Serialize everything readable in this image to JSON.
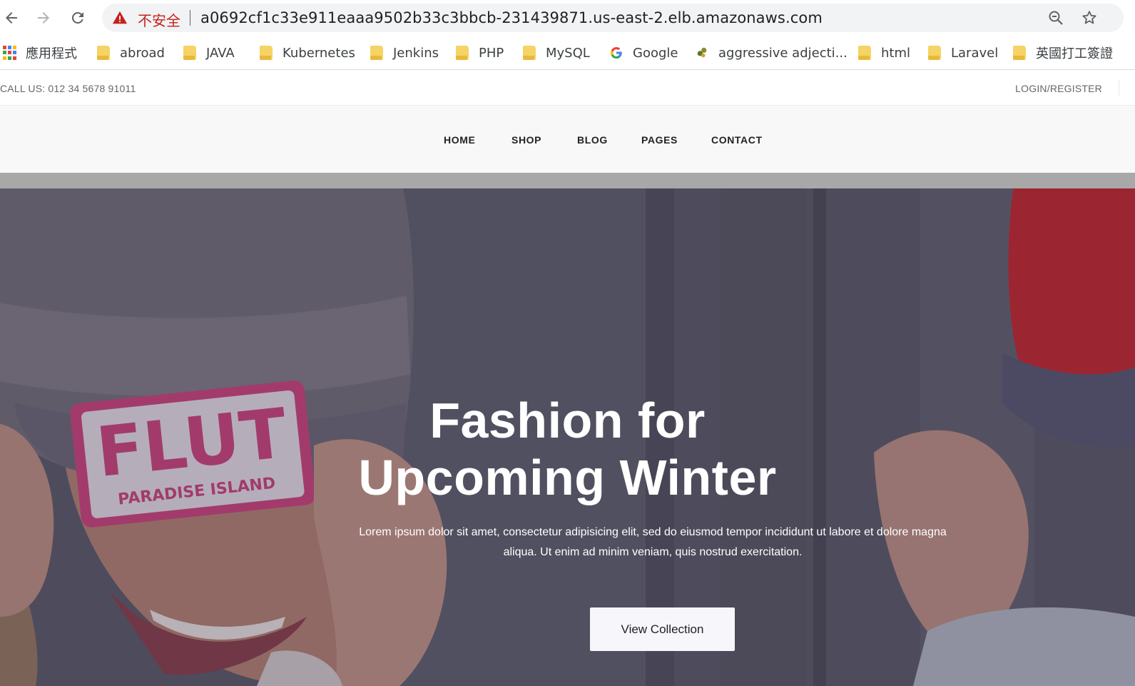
{
  "browser": {
    "security_label": "不安全",
    "url": "a0692cf1c33e911eaaa9502b33c3bbcb-231439871.us-east-2.elb.amazonaws.com",
    "icons": [
      "back-arrow-icon",
      "forward-arrow-icon",
      "reload-icon",
      "warning-triangle-icon",
      "zoom-icon",
      "star-icon"
    ]
  },
  "bookmarks": [
    {
      "label": "應用程式",
      "icon": "apps-grid-icon"
    },
    {
      "label": "abroad",
      "icon": "folder-icon"
    },
    {
      "label": "JAVA",
      "icon": "folder-icon"
    },
    {
      "label": "Kubernetes",
      "icon": "folder-icon"
    },
    {
      "label": "Jenkins",
      "icon": "folder-icon"
    },
    {
      "label": "PHP",
      "icon": "folder-icon"
    },
    {
      "label": "MySQL",
      "icon": "folder-icon"
    },
    {
      "label": "Google",
      "icon": "google-icon"
    },
    {
      "label": "aggressive adjecti...",
      "icon": "site-favicon-icon"
    },
    {
      "label": "html",
      "icon": "folder-icon"
    },
    {
      "label": "Laravel",
      "icon": "folder-icon"
    },
    {
      "label": "英國打工簽證",
      "icon": "folder-icon"
    }
  ],
  "topbar": {
    "call_us": "CALL US: 012 34 5678 91011",
    "login": "LOGIN/REGISTER"
  },
  "nav": {
    "items": [
      "HOME",
      "SHOP",
      "BLOG",
      "PAGES",
      "CONTACT"
    ]
  },
  "hero": {
    "title_line1": "Fashion for",
    "title_line2": "Upcoming Winter",
    "description_line1": "Lorem ipsum dolor sit amet, consectetur adipisicing elit, sed do eiusmod tempor incididunt ut labore et dolore magna",
    "description_line2": "aliqua. Ut enim ad minim veniam, quis nostrud exercitation.",
    "button": "View Collection",
    "patch_text_main": "FLUT",
    "patch_text_sub": "PARADISE ISLAND"
  },
  "colors": {
    "warning_red": "#c5221f",
    "folder_yellow": "#f6d365",
    "hat_pink": "#d2457f",
    "hat_red": "#c8282f"
  }
}
